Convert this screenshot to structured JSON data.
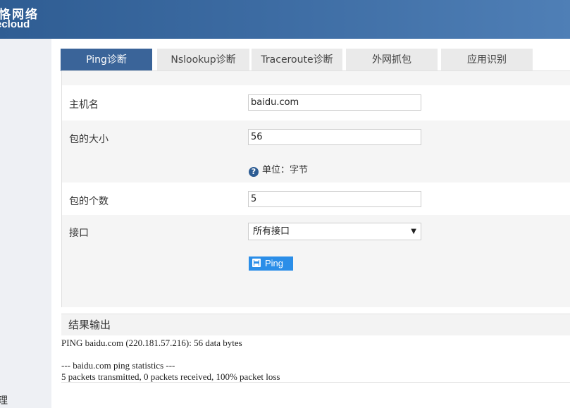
{
  "brand": {
    "name_cn": "恪网络",
    "name_en": "ecloud"
  },
  "sidebar": {
    "label": "理"
  },
  "tabs": [
    {
      "label": "Ping诊断",
      "active": true
    },
    {
      "label": "Nslookup诊断",
      "active": false
    },
    {
      "label": "Traceroute诊断",
      "active": false
    },
    {
      "label": "外网抓包",
      "active": false
    },
    {
      "label": "应用识别",
      "active": false
    }
  ],
  "form": {
    "host_label": "主机名",
    "host_value": "baidu.com",
    "size_label": "包的大小",
    "size_value": "56",
    "size_hint": "单位：字节",
    "count_label": "包的个数",
    "count_value": "5",
    "iface_label": "接口",
    "iface_selected": "所有接口",
    "ping_button": "Ping"
  },
  "result": {
    "title": "结果输出",
    "output": "PING baidu.com (220.181.57.216): 56 data bytes\n\n--- baidu.com ping statistics ---\n5 packets transmitted, 0 packets received, 100% packet loss"
  },
  "colors": {
    "header": "#3a6499",
    "active_tab": "#3a6499",
    "button": "#2b8ee8"
  }
}
